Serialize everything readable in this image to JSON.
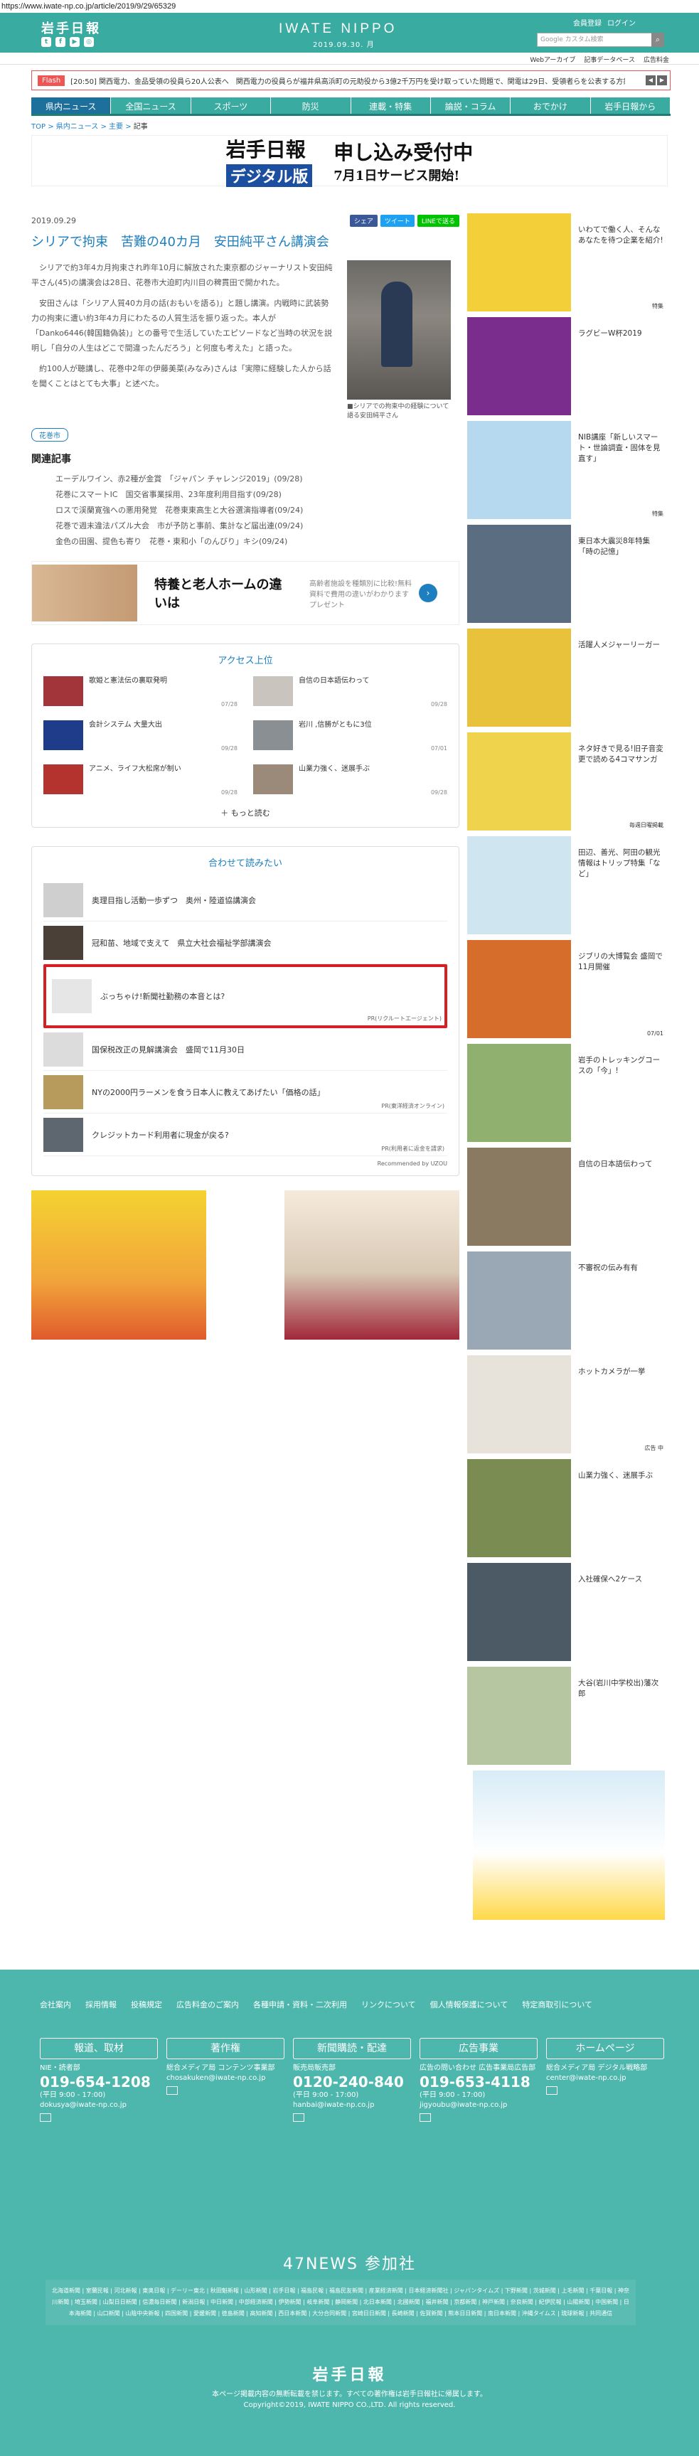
{
  "url": "https://www.iwate-np.co.jp/article/2019/9/29/65329",
  "header": {
    "logo": "岩手日報",
    "brand": "IWATE NIPPO",
    "date": "2019.09.30. 月",
    "links": [
      "会員登録",
      "ログイン"
    ],
    "search_placeholder": "Google カスタム検索"
  },
  "subnav": [
    "Webアーカイブ",
    "記事データベース",
    "広告料金"
  ],
  "flash": {
    "label": "Flash",
    "text": "[20:50] 関西電力、金品受領の役員ら20人公表へ　関西電力の役員らが福井県高浜町の元助役から3億2千万円を受け取っていた問題で、関電は29日、受領者らを公表する方針…"
  },
  "gnav": [
    "県内ニュース",
    "全国ニュース",
    "スポーツ",
    "防災",
    "連載・特集",
    "論説・コラム",
    "おでかけ",
    "岩手日報から"
  ],
  "breadcrumb": [
    "TOP",
    "県内ニュース",
    "主要",
    "記事"
  ],
  "banner": {
    "left": "岩手日報",
    "digital": "デジタル版",
    "right": "申し込み受付中",
    "sub": "7月1日サービス開始!"
  },
  "article": {
    "date": "2019.09.29",
    "share": [
      "シェア",
      "ツイート",
      "LINEで送る"
    ],
    "title": "シリアで拘束　苦難の40カ月　安田純平さん講演会",
    "paragraphs": [
      "シリアで約3年4カ月拘束され昨年10月に解放された東京都のジャーナリスト安田純平さん(45)の講演会は28日、花巻市大迫町内川目の稗貫田で開かれた。",
      "安田さんは「シリア人質40カ月の話(おもいを語る)」と題し講演。内戦時に武装勢力の拘束に遭い約3年4カ月にわたるの人質生活を振り返った。本人が「Danko6446(韓国籍偽装)」との番号で生活していたエピソードなど当時の状況を説明し「自分の人生はどこで間違ったんだろう」と何度も考えた」と語った。",
      "約100人が聴講し、花巻中2年の伊藤美菜(みなみ)さんは「実際に経験した人から話を聞くことはとても大事」と述べた。"
    ],
    "photo_caption": "■シリアでの拘束中の経験について語る安田純平さん",
    "tag": "花巻市",
    "related_title": "関連記事",
    "related": [
      "エーデルワイン、赤2種が金賞　「ジャパン チャレンジ2019」(09/28)",
      "花巻にスマートIC　国交省事業採用、23年度利用目指す(09/28)",
      "ロスで渓蘭寛強への悪用発覚　花巻東東高生と大谷選演指導者(09/24)",
      "花巻で週末違法パズル大会　市が予防と事前、集計など届出連(09/24)",
      "金色の田園、提色も寄り　花巻・東和小「のんびり」キシ(09/24)"
    ]
  },
  "ad": {
    "title": "特養と老人ホームの違いは",
    "desc": "高齢者施設を種類別に比較!無料資料で費用の違いがわかります プレゼント"
  },
  "access": {
    "title": "アクセス上位",
    "items": [
      {
        "text": "歌姫と憲法伝の裏取発明",
        "date": "07/28"
      },
      {
        "text": "自信の日本語伝わって",
        "date": "09/28"
      },
      {
        "text": "会計システム 大量大出",
        "date": "09/28"
      },
      {
        "text": "岩川 ,信勝がともに3位",
        "date": "07/01"
      },
      {
        "text": "アニメ、ライフ大松席が制い",
        "date": "09/28"
      },
      {
        "text": "山業力強く、迷展手ぶ",
        "date": "09/28"
      }
    ],
    "more": "もっと読む"
  },
  "reco": {
    "title": "合わせて読みたい",
    "items": [
      {
        "text": "奥理目指し活動一歩ずつ　奥州・陸道協講演会",
        "pr": ""
      },
      {
        "text": "冠和苗、地域で支えて　県立大社会福祉学部講演会",
        "pr": ""
      },
      {
        "text": "ぶっちゃけ!新聞社勤務の本音とは?",
        "pr": "PR(リクルートエージェント)"
      },
      {
        "text": "国保税改正の見解講演会　盛岡で11月30日",
        "pr": ""
      },
      {
        "text": "NYの2000円ラーメンを食う日本人に教えてあげたい「価格の話」",
        "pr": "PR(東洋経済オンライン)"
      },
      {
        "text": "クレジットカード利用者に現金が戻る?",
        "pr": "PR(利用者に返金を請求)"
      }
    ],
    "recommended_by": "Recommended by UZOU"
  },
  "sidebar": [
    {
      "text": "いわてで働く人、そんなあなたを待つ企業を紹介!",
      "label": "特集"
    },
    {
      "text": "ラグビーW杯2019",
      "label": ""
    },
    {
      "text": "NIB講座「新しいスマート・世論調査・固体を見直す」",
      "label": "特集"
    },
    {
      "text": "東日本大震災8年特集「時の記憶」",
      "label": ""
    },
    {
      "text": "活躍人メジャーリーガー",
      "label": ""
    },
    {
      "text": "ネタ好きで見る!旧子音変更で読める4コマサンガ",
      "label": "毎週日曜掲載"
    },
    {
      "text": "田辺、善光、阿田の観光情報はトリップ特集「など」",
      "label": ""
    },
    {
      "text": "ジブリの大博覧会 盛岡で11月開催",
      "label": "07/01"
    },
    {
      "text": "岩手のトレッキングコースの「今」!",
      "label": ""
    },
    {
      "text": "自信の日本語伝わって",
      "label": ""
    },
    {
      "text": "不審祝の伝み有有",
      "label": ""
    },
    {
      "text": "ホットカメラが一挙",
      "label": "広告 中"
    },
    {
      "text": "山業力強く、迷展手ぶ",
      "label": ""
    },
    {
      "text": "入社確保へ2ケース",
      "label": ""
    },
    {
      "text": "大谷(岩川中学校出)藩次郎",
      "label": ""
    }
  ],
  "footer": {
    "links": [
      "会社案内",
      "採用情報",
      "投稿規定",
      "広告料金のご案内",
      "各種申請・資料・二次利用",
      "リンクについて",
      "個人情報保護について",
      "特定商取引について"
    ],
    "cols": [
      {
        "head": "報道、取材",
        "name": "NIE・読者部",
        "tel": "019-654-1208",
        "hours": "(平日 9:00 - 17:00)",
        "mail": "dokusya@iwate-np.co.jp"
      },
      {
        "head": "著作権",
        "name": "総合メディア局 コンテンツ事業部",
        "tel": "",
        "hours": "",
        "mail": "chosakuken@iwate-np.co.jp"
      },
      {
        "head": "新聞購読・配達",
        "name": "販売局販売部",
        "tel": "0120-240-840",
        "hours": "(平日 9:00 - 17:00)",
        "mail": "hanbai@iwate-np.co.jp"
      },
      {
        "head": "広告事業",
        "name": "広告の問い合わせ 広告事業局広告部",
        "tel": "019-653-4118",
        "hours": "(平日 9:00 - 17:00)",
        "mail": "jigyoubu@iwate-np.co.jp"
      },
      {
        "head": "ホームページ",
        "name": "総合メディア局 デジタル戦略部",
        "tel": "",
        "hours": "",
        "mail": "center@iwate-np.co.jp"
      }
    ],
    "n47": "47NEWS 参加社",
    "n47list": "北海道新聞 | 室蘭民報 | 河北新報 | 東奥日報 | デーリー東北 | 秋田魁新報 | 山形新聞 | 岩手日報 | 福島民報 | 福島民友新聞 | 産業経済新聞 | 日本経済新聞社 | ジャパンタイムズ | 下野新聞 | 茨城新聞 | 上毛新聞 | 千葉日報 | 神奈川新聞 | 埼玉新聞 | 山梨日日新聞 | 信濃毎日新聞 | 新潟日報 | 中日新聞 | 中部経済新聞 | 伊勢新聞 | 岐阜新聞 | 静岡新聞 | 北日本新聞 | 北國新聞 | 福井新聞 | 京都新聞 | 神戸新聞 | 奈良新聞 | 紀伊民報 | 山陽新聞 | 中国新聞 | 日本海新聞 | 山口新聞 | 山陰中央新報 | 四国新聞 | 愛媛新聞 | 徳島新聞 | 高知新聞 | 西日本新聞 | 大分合同新聞 | 宮崎日日新聞 | 長崎新聞 | 佐賀新聞 | 熊本日日新聞 | 南日本新聞 | 沖縄タイムス | 琉球新報 | 共同通信",
    "logo": "岩手日報",
    "copy1": "本ページ掲載内容の無断転載を禁じます。すべての著作権は岩手日報社に帰属します。",
    "copy2": "Copyright©2019, IWATE NIPPO CO.,LTD. All rights reserved."
  }
}
